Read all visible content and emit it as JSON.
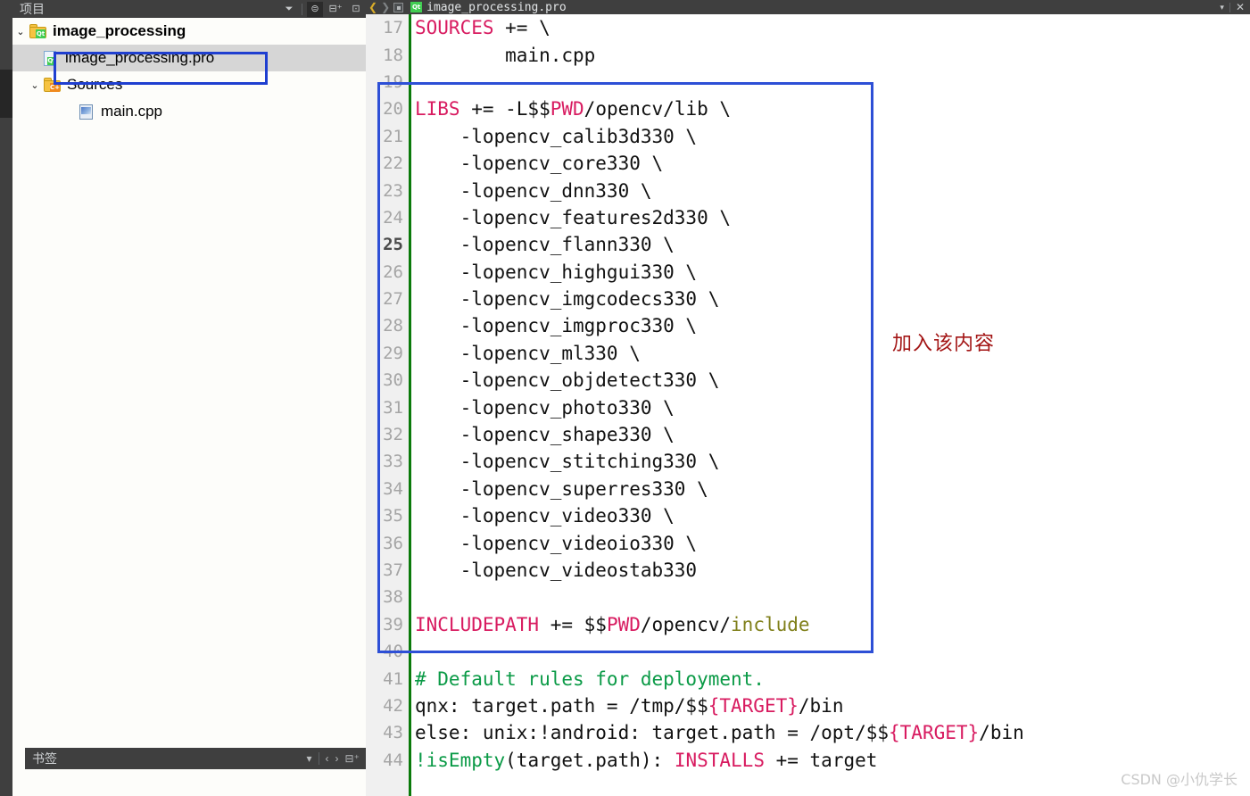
{
  "colors": {
    "accent_blue": "#2d4fd6",
    "annotation_red": "#a31515",
    "keyword_magenta": "#d81b60",
    "comment_green": "#0a9a46",
    "selection_olive": "#7f7f19",
    "panel_dark": "#3f3f3f",
    "modified_bar_green": "#0a7a0a"
  },
  "sidebar": {
    "header_title": "项目",
    "header_tools": [
      {
        "name": "filter-icon",
        "glyph": "⏷"
      },
      {
        "name": "sync-link-icon",
        "glyph": "⊜"
      },
      {
        "name": "split-add-icon",
        "glyph": "⊟⁺"
      },
      {
        "name": "close-panel-icon",
        "glyph": "⊡"
      }
    ],
    "tree": [
      {
        "label": "image_processing",
        "icon": "qt-project-folder-icon",
        "indent": 0,
        "expanded": true,
        "bold": true,
        "selected": false
      },
      {
        "label": "image_processing.pro",
        "icon": "qt-pro-file-icon",
        "indent": 1,
        "expanded": null,
        "bold": false,
        "selected": true
      },
      {
        "label": "Sources",
        "icon": "cpp-sources-folder-icon",
        "indent": 1,
        "expanded": true,
        "bold": false,
        "selected": false
      },
      {
        "label": "main.cpp",
        "icon": "cpp-file-icon",
        "indent": 2,
        "expanded": null,
        "bold": false,
        "selected": false
      }
    ]
  },
  "bookmarks_bar": {
    "title": "书签",
    "controls": [
      {
        "name": "bookmarks-dropdown-caret",
        "glyph": "▾"
      },
      {
        "name": "prev-bookmark-icon",
        "glyph": "‹"
      },
      {
        "name": "next-bookmark-icon",
        "glyph": "›"
      },
      {
        "name": "split-add-icon",
        "glyph": "⊟⁺"
      },
      {
        "name": "close-panel-icon",
        "glyph": "⊡"
      }
    ]
  },
  "editor": {
    "tab": {
      "filename": "image_processing.pro",
      "icon": "qt-pro-file-icon",
      "back_arrow": "❮",
      "forward_arrow": "❯",
      "dropdown_caret": "▾",
      "close_label": "✕"
    },
    "lines": [
      {
        "num": "17",
        "current": false,
        "tokens": [
          {
            "t": "SOURCES",
            "c": "kw"
          },
          {
            "t": " += \\",
            "c": "op"
          }
        ]
      },
      {
        "num": "18",
        "current": false,
        "tokens": [
          {
            "t": "        main.cpp",
            "c": "op"
          }
        ]
      },
      {
        "num": "19",
        "current": false,
        "tokens": [
          {
            "t": "",
            "c": "op"
          }
        ]
      },
      {
        "num": "20",
        "current": false,
        "tokens": [
          {
            "t": "LIBS",
            "c": "kw"
          },
          {
            "t": " += -L$$",
            "c": "op"
          },
          {
            "t": "PWD",
            "c": "var"
          },
          {
            "t": "/opencv/lib \\",
            "c": "op"
          }
        ]
      },
      {
        "num": "21",
        "current": false,
        "tokens": [
          {
            "t": "    -lopencv_calib3d330 \\",
            "c": "op"
          }
        ]
      },
      {
        "num": "22",
        "current": false,
        "tokens": [
          {
            "t": "    -lopencv_core330 \\",
            "c": "op"
          }
        ]
      },
      {
        "num": "23",
        "current": false,
        "tokens": [
          {
            "t": "    -lopencv_dnn330 \\",
            "c": "op"
          }
        ]
      },
      {
        "num": "24",
        "current": false,
        "tokens": [
          {
            "t": "    -lopencv_features2d330 \\",
            "c": "op"
          }
        ]
      },
      {
        "num": "25",
        "current": true,
        "tokens": [
          {
            "t": "    -lopencv_flann330 \\",
            "c": "op"
          }
        ]
      },
      {
        "num": "26",
        "current": false,
        "tokens": [
          {
            "t": "    -lopencv_highgui330 \\",
            "c": "op"
          }
        ]
      },
      {
        "num": "27",
        "current": false,
        "tokens": [
          {
            "t": "    -lopencv_imgcodecs330 \\",
            "c": "op"
          }
        ]
      },
      {
        "num": "28",
        "current": false,
        "tokens": [
          {
            "t": "    -lopencv_imgproc330 \\",
            "c": "op"
          }
        ]
      },
      {
        "num": "29",
        "current": false,
        "tokens": [
          {
            "t": "    -lopencv_ml330 \\",
            "c": "op"
          }
        ]
      },
      {
        "num": "30",
        "current": false,
        "tokens": [
          {
            "t": "    -lopencv_objdetect330 \\",
            "c": "op"
          }
        ]
      },
      {
        "num": "31",
        "current": false,
        "tokens": [
          {
            "t": "    -lopencv_photo330 \\",
            "c": "op"
          }
        ]
      },
      {
        "num": "32",
        "current": false,
        "tokens": [
          {
            "t": "    -lopencv_shape330 \\",
            "c": "op"
          }
        ]
      },
      {
        "num": "33",
        "current": false,
        "tokens": [
          {
            "t": "    -lopencv_stitching330 \\",
            "c": "op"
          }
        ]
      },
      {
        "num": "34",
        "current": false,
        "tokens": [
          {
            "t": "    -lopencv_superres330 \\",
            "c": "op"
          }
        ]
      },
      {
        "num": "35",
        "current": false,
        "tokens": [
          {
            "t": "    -lopencv_video330 \\",
            "c": "op"
          }
        ]
      },
      {
        "num": "36",
        "current": false,
        "tokens": [
          {
            "t": "    -lopencv_videoio330 \\",
            "c": "op"
          }
        ]
      },
      {
        "num": "37",
        "current": false,
        "tokens": [
          {
            "t": "    -lopencv_videostab330",
            "c": "op"
          }
        ]
      },
      {
        "num": "38",
        "current": false,
        "tokens": [
          {
            "t": "",
            "c": "op"
          }
        ]
      },
      {
        "num": "39",
        "current": false,
        "tokens": [
          {
            "t": "INCLUDEPATH",
            "c": "kw"
          },
          {
            "t": " += $$",
            "c": "op"
          },
          {
            "t": "PWD",
            "c": "var"
          },
          {
            "t": "/opencv/",
            "c": "op"
          },
          {
            "t": "include",
            "c": "sel"
          }
        ]
      },
      {
        "num": "40",
        "current": false,
        "tokens": [
          {
            "t": "",
            "c": "op"
          }
        ]
      },
      {
        "num": "41",
        "current": false,
        "tokens": [
          {
            "t": "# Default rules for deployment.",
            "c": "cmt"
          }
        ]
      },
      {
        "num": "42",
        "current": false,
        "tokens": [
          {
            "t": "qnx: target.path = /tmp/$$",
            "c": "op"
          },
          {
            "t": "{TARGET}",
            "c": "var"
          },
          {
            "t": "/bin",
            "c": "op"
          }
        ]
      },
      {
        "num": "43",
        "current": false,
        "tokens": [
          {
            "t": "else: unix:!android: target.path = /opt/$$",
            "c": "op"
          },
          {
            "t": "{TARGET}",
            "c": "var"
          },
          {
            "t": "/bin",
            "c": "op"
          }
        ]
      },
      {
        "num": "44",
        "current": false,
        "tokens": [
          {
            "t": "!isEmpty",
            "c": "cmt"
          },
          {
            "t": "(target.path): ",
            "c": "op"
          },
          {
            "t": "INSTALLS",
            "c": "kw"
          },
          {
            "t": " += target",
            "c": "op"
          }
        ]
      }
    ]
  },
  "annotations": {
    "code_note": "加入该内容",
    "file_highlight_target": "image_processing.pro",
    "code_highlight_range": "lines 19-39"
  },
  "watermark": "CSDN @小仇学长"
}
